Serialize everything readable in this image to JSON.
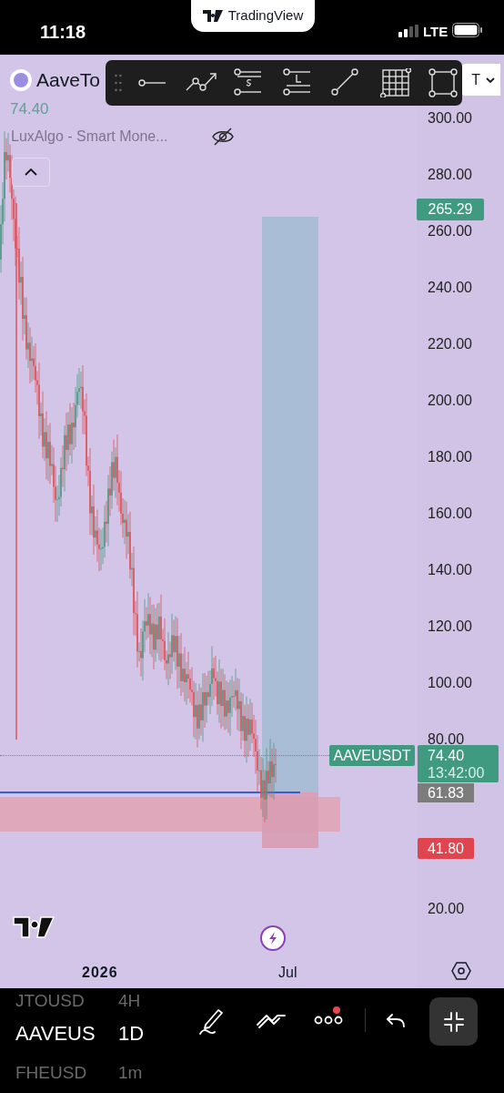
{
  "status_bar": {
    "time": "11:18",
    "network": "LTE"
  },
  "app_banner": {
    "label": "TradingView"
  },
  "symbol_header": {
    "name": "AaveTo",
    "selector": "T"
  },
  "drawing_toolbar": {
    "tools": [
      {
        "kind": "horizontal-ray"
      },
      {
        "kind": "path"
      },
      {
        "kind": "short-position"
      },
      {
        "kind": "long-position"
      },
      {
        "kind": "trend-line"
      },
      {
        "kind": "grid"
      },
      {
        "kind": "rectangle"
      }
    ]
  },
  "legend": {
    "price": "74.40",
    "indicator": "LuxAlgo - Smart Mone...",
    "indicator_hidden": true
  },
  "price_axis": {
    "labels": [
      "300.00",
      "280.00",
      "260.00",
      "240.00",
      "220.00",
      "200.00",
      "180.00",
      "160.00",
      "140.00",
      "120.00",
      "100.00",
      "80.00",
      "20.00"
    ]
  },
  "price_tags": [
    {
      "kind": "target",
      "text": "265.29"
    },
    {
      "kind": "symbol",
      "text": "AAVEUSDT"
    },
    {
      "kind": "last",
      "text": "74.40",
      "countdown": "13:42:00"
    },
    {
      "kind": "entry",
      "text": "61.83"
    },
    {
      "kind": "stop",
      "text": "41.80"
    }
  ],
  "time_axis": [
    {
      "kind": "year",
      "label": "2026"
    },
    {
      "kind": "month",
      "label": "Jul"
    }
  ],
  "bottom_bar": {
    "symbols": [
      {
        "symbol": "JTOUSD",
        "interval": "4H",
        "selected": false
      },
      {
        "symbol": "AAVEUS",
        "interval": "1D",
        "selected": true
      },
      {
        "symbol": "FHEUSD",
        "interval": "1m",
        "selected": false
      }
    ],
    "more_notification": true
  }
}
